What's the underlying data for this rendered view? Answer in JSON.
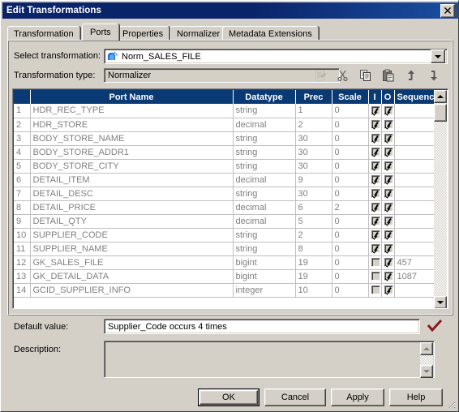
{
  "window": {
    "title": "Edit Transformations",
    "close_label": "✕"
  },
  "tabs": [
    {
      "label": "Transformation",
      "selected": false
    },
    {
      "label": "Ports",
      "selected": true
    },
    {
      "label": "Properties",
      "selected": false
    },
    {
      "label": "Normalizer",
      "selected": false
    },
    {
      "label": "Metadata Extensions",
      "selected": false
    }
  ],
  "form": {
    "select_transformation_label": "Select transformation:",
    "select_transformation_value": "Norm_SALES_FILE",
    "transformation_type_label": "Transformation type:",
    "transformation_type_value": "Normalizer",
    "default_value_label": "Default value:",
    "default_value": "Supplier_Code occurs 4 times",
    "description_label": "Description:",
    "description_value": ""
  },
  "toolbar": [
    {
      "name": "add-new-port-icon",
      "title": "Add new port",
      "disabled": true
    },
    {
      "name": "cut-icon",
      "title": "Cut",
      "disabled": false
    },
    {
      "name": "copy-icon",
      "title": "Copy",
      "disabled": false
    },
    {
      "name": "paste-icon",
      "title": "Paste",
      "disabled": false
    },
    {
      "name": "move-up-icon",
      "title": "Move up",
      "disabled": false
    },
    {
      "name": "move-down-icon",
      "title": "Move down",
      "disabled": false
    }
  ],
  "grid": {
    "columns": [
      "Port Name",
      "Datatype",
      "Prec",
      "Scale",
      "I",
      "O",
      "Sequence"
    ],
    "rows": [
      {
        "num": "1",
        "port": "HDR_REC_TYPE",
        "datatype": "string",
        "prec": "1",
        "scale": "0",
        "i": true,
        "o": true,
        "sequence": "",
        "selected": false
      },
      {
        "num": "2",
        "port": "HDR_STORE",
        "datatype": "decimal",
        "prec": "2",
        "scale": "0",
        "i": true,
        "o": true,
        "sequence": "",
        "selected": false
      },
      {
        "num": "3",
        "port": "BODY_STORE_NAME",
        "datatype": "string",
        "prec": "30",
        "scale": "0",
        "i": true,
        "o": true,
        "sequence": "",
        "selected": false
      },
      {
        "num": "4",
        "port": "BODY_STORE_ADDR1",
        "datatype": "string",
        "prec": "30",
        "scale": "0",
        "i": true,
        "o": true,
        "sequence": "",
        "selected": false
      },
      {
        "num": "5",
        "port": "BODY_STORE_CITY",
        "datatype": "string",
        "prec": "30",
        "scale": "0",
        "i": true,
        "o": true,
        "sequence": "",
        "selected": false
      },
      {
        "num": "6",
        "port": "DETAIL_ITEM",
        "datatype": "decimal",
        "prec": "9",
        "scale": "0",
        "i": true,
        "o": true,
        "sequence": "",
        "selected": false
      },
      {
        "num": "7",
        "port": "DETAIL_DESC",
        "datatype": "string",
        "prec": "30",
        "scale": "0",
        "i": true,
        "o": true,
        "sequence": "",
        "selected": false
      },
      {
        "num": "8",
        "port": "DETAIL_PRICE",
        "datatype": "decimal",
        "prec": "6",
        "scale": "2",
        "i": true,
        "o": true,
        "sequence": "",
        "selected": false
      },
      {
        "num": "9",
        "port": "DETAIL_QTY",
        "datatype": "decimal",
        "prec": "5",
        "scale": "0",
        "i": true,
        "o": true,
        "sequence": "",
        "selected": false
      },
      {
        "num": "10",
        "port": "SUPPLIER_CODE",
        "datatype": "string",
        "prec": "2",
        "scale": "0",
        "i": true,
        "o": true,
        "sequence": "",
        "selected": true
      },
      {
        "num": "11",
        "port": "SUPPLIER_NAME",
        "datatype": "string",
        "prec": "8",
        "scale": "0",
        "i": true,
        "o": true,
        "sequence": "",
        "selected": false
      },
      {
        "num": "12",
        "port": "GK_SALES_FILE",
        "datatype": "bigint",
        "prec": "19",
        "scale": "0",
        "i": false,
        "o": true,
        "sequence": "457",
        "selected": false
      },
      {
        "num": "13",
        "port": "GK_DETAIL_DATA",
        "datatype": "bigint",
        "prec": "19",
        "scale": "0",
        "i": false,
        "o": true,
        "sequence": "1087",
        "selected": false
      },
      {
        "num": "14",
        "port": "GCID_SUPPLIER_INFO",
        "datatype": "integer",
        "prec": "10",
        "scale": "0",
        "i": false,
        "o": true,
        "sequence": "",
        "selected": false
      }
    ]
  },
  "buttons": {
    "ok": "OK",
    "cancel": "Cancel",
    "apply": "Apply",
    "help": "Help"
  },
  "colors": {
    "titlebar": "#0a246a",
    "header": "#0a3a73",
    "face": "#d4d0c8",
    "checkmark": "#8b1a1a"
  }
}
